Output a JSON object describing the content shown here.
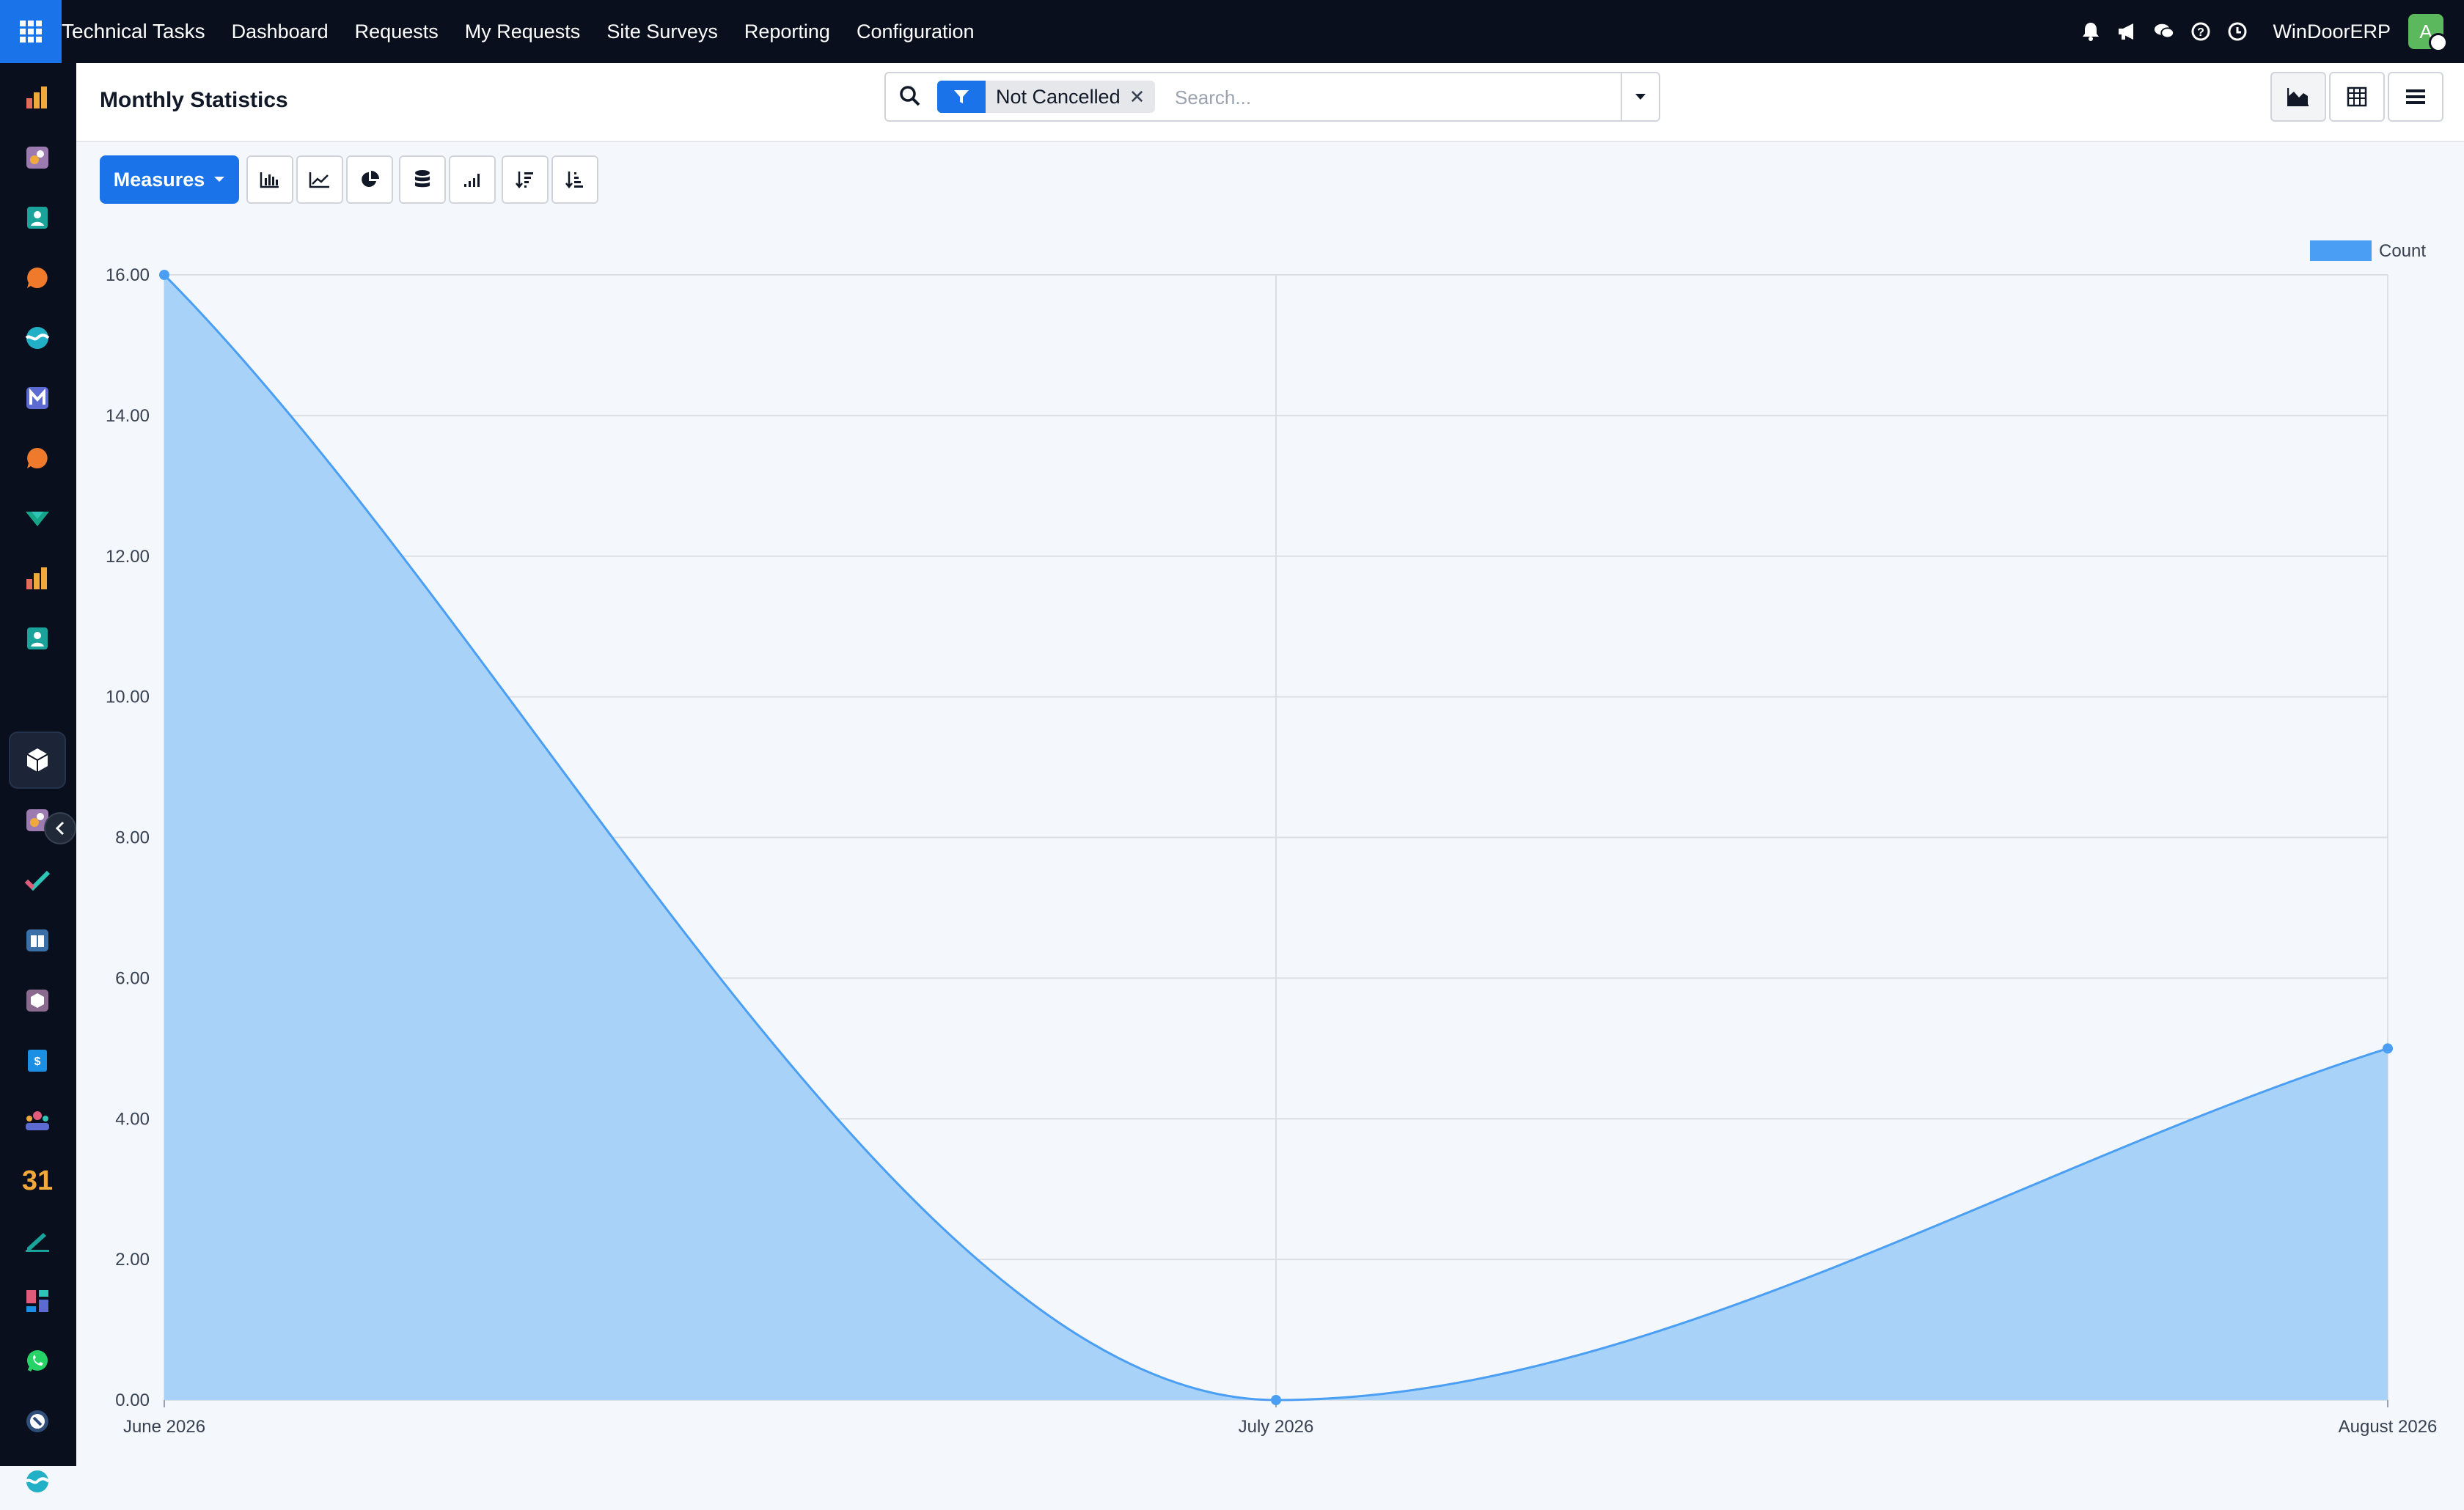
{
  "topnav": {
    "app_name": "Technical Tasks",
    "items": [
      "Dashboard",
      "Requests",
      "My Requests",
      "Site Surveys",
      "Reporting",
      "Configuration"
    ],
    "company": "WinDoorERP",
    "avatar_initial": "A",
    "icons": [
      "bell-icon",
      "megaphone-icon",
      "chat-icon",
      "help-icon",
      "clock-icon"
    ]
  },
  "sidebar": {
    "apps": [
      "sales-chart-icon",
      "puzzle-icon",
      "contacts-icon",
      "chat-bubble-icon",
      "wave-icon",
      "mail-icon",
      "chat-bubble-icon",
      "tag-icon",
      "sales-chart-icon",
      "contacts-icon",
      "box-icon",
      "puzzle-icon",
      "check-icon",
      "book-icon",
      "cube-icon",
      "invoice-icon",
      "team-icon",
      "calendar-icon",
      "sign-icon",
      "dashboard-icon",
      "whatsapp-icon",
      "compass-icon",
      "wave-icon"
    ],
    "active_index": 10,
    "calendar_label": "31"
  },
  "control_panel": {
    "title": "Monthly Statistics",
    "filter_facet": "Not Cancelled",
    "search_placeholder": "Search...",
    "views": [
      "graph-view",
      "pivot-view",
      "list-view"
    ]
  },
  "toolbar": {
    "measures_label": "Measures",
    "buttons": [
      "bar-chart-icon",
      "line-chart-icon",
      "pie-chart-icon",
      "stacked-icon",
      "cumulative-icon",
      "sort-descending-icon",
      "sort-ascending-icon"
    ]
  },
  "chart_data": {
    "type": "area",
    "categories": [
      "June 2026",
      "July 2026",
      "August 2026"
    ],
    "series": [
      {
        "name": "Count",
        "values": [
          16,
          0,
          5
        ],
        "color": "#4a9ff5"
      }
    ],
    "ylim": [
      0,
      16
    ],
    "yticks": [
      "0.00",
      "2.00",
      "4.00",
      "6.00",
      "8.00",
      "10.00",
      "12.00",
      "14.00",
      "16.00"
    ],
    "grid": true,
    "legend": "top-right"
  },
  "colors": {
    "accent": "#1a73e8",
    "topbar": "#0a0f1d",
    "area_fill": "#a8d2f7",
    "line": "#4a9ff5"
  }
}
